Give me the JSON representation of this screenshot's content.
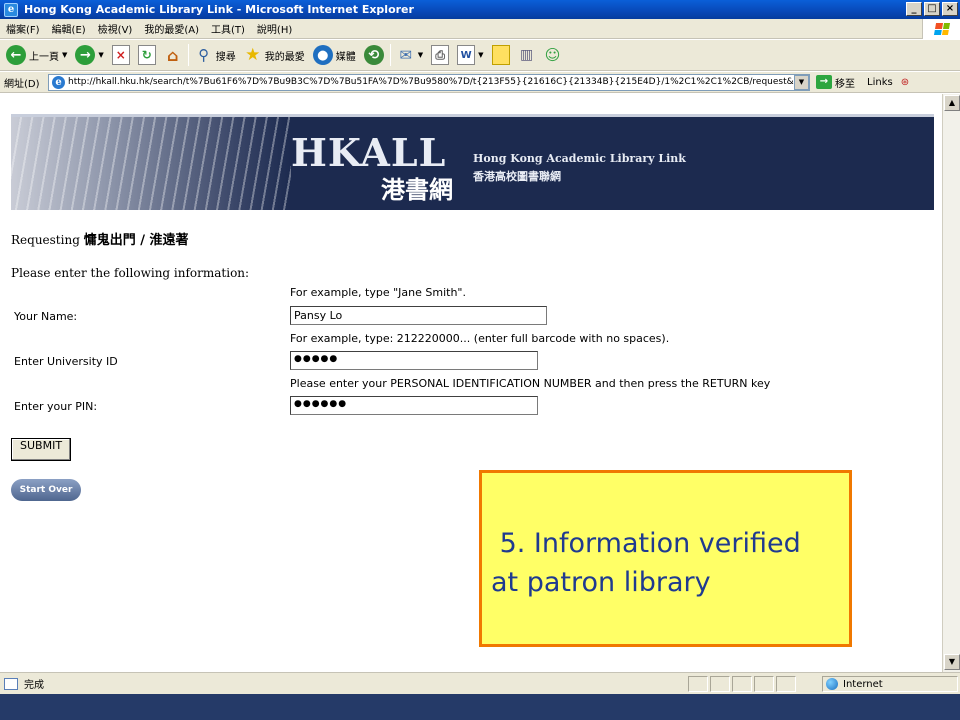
{
  "window": {
    "title": "Hong Kong Academic Library Link - Microsoft Internet Explorer",
    "minimize": "_",
    "maximize": "□",
    "close": "×"
  },
  "menu": [
    "檔案(F)",
    "編輯(E)",
    "檢視(V)",
    "我的最愛(A)",
    "工具(T)",
    "說明(H)"
  ],
  "toolbar": {
    "back_label": "上一頁",
    "search_label": "搜尋",
    "favorites_label": "我的最愛",
    "media_label": "媒體"
  },
  "address": {
    "label": "網址(D)",
    "url": "http://hkall.hku.hk/search/t%7Bu61F6%7D%7Bu9B3C%7D%7Bu51FA%7D%7Bu9580%7D/t{213F55}{21616C}{21334B}{215E4D}/1%2C1%2C1%2CB/request&F",
    "go_label": "移至",
    "links_label": "Links"
  },
  "banner": {
    "title": "HKALL",
    "chinese_title": "港書網",
    "subtitle_en": "Hong Kong Academic Library Link",
    "subtitle_zh": "香港高校圖書聯網"
  },
  "form": {
    "requesting_prefix": "Requesting",
    "requesting_item": "慵鬼出門 / 淮遠著",
    "instruction": "Please enter the following information:",
    "name_hint": "For example, type \"Jane Smith\".",
    "name_label": "Your Name:",
    "name_value": "Pansy Lo",
    "id_hint": "For example, type: 212220000... (enter full barcode with no spaces).",
    "id_label": "Enter University ID",
    "id_value": "●●●●●",
    "pin_hint": "Please enter your PERSONAL IDENTIFICATION NUMBER and then press the RETURN key",
    "pin_label": "Enter your PIN:",
    "pin_value": "●●●●●●",
    "submit_label": "SUBMIT",
    "start_over_label": "Start Over"
  },
  "callout": {
    "text": " 5. Information verified\nat patron library"
  },
  "status": {
    "text": "完成",
    "zone": "Internet"
  },
  "colors": {
    "title_bar": "#0848b8",
    "banner_bg": "#1c2a4f",
    "callout_bg": "#ffff66",
    "callout_border": "#f07800",
    "callout_text": "#1f3a90",
    "taskbar": "#253a68"
  }
}
